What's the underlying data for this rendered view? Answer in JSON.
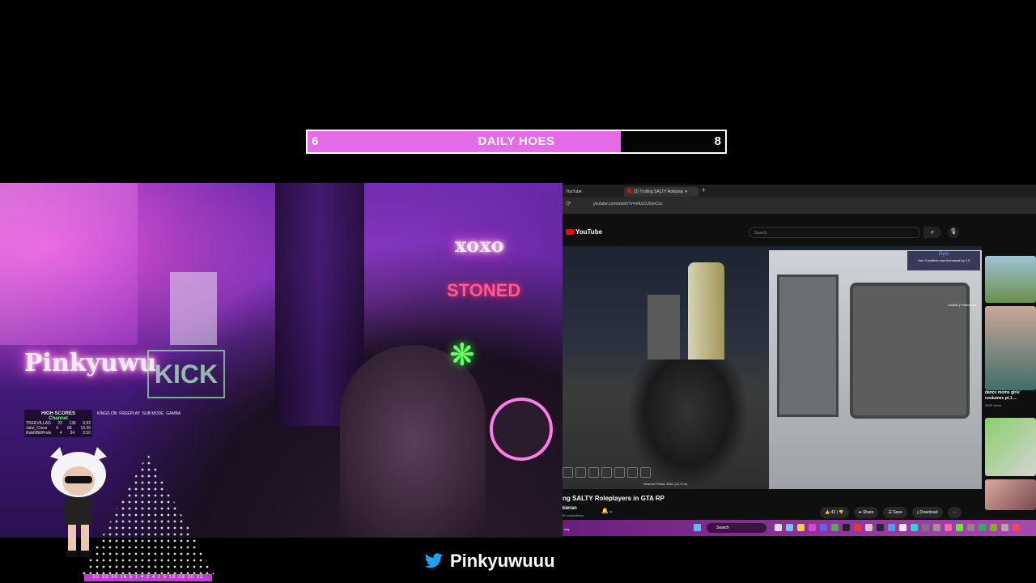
{
  "goal": {
    "title": "DAILY HOES",
    "current": "6",
    "target": "8",
    "progress": 0.75,
    "color": "#e46ce8"
  },
  "webcam": {
    "neon_name": "Pinkyuwu",
    "neon_xoxo": "xoxo",
    "neon_stoned": "STONED",
    "kick_sign": "KICK",
    "scoreboard": {
      "title": "HIGH SCORES",
      "subtitle": "Channel",
      "rows": [
        {
          "name": "TREEVILLAG",
          "a": "23",
          "b": "136",
          "c": "3.92"
        },
        {
          "name": "Jake_Cress",
          "a": "6",
          "b": "66",
          "c": "13.35"
        },
        {
          "name": "RobRBillProfe",
          "a": "4",
          "b": "34",
          "c": "3.50"
        }
      ]
    },
    "stats": {
      "lines": [
        "KINGS ON",
        "FREEPLAY",
        "SUB MODE",
        "GAMBA"
      ]
    }
  },
  "browser": {
    "tabs": [
      "YouTube",
      "(2) Trolling SALTY Roleplay"
    ],
    "url": "youtube.com/watch?v=mKoCUGorCxc",
    "yt_logo": "YouTube",
    "search_placeholder": "Search",
    "hud": {
      "notice_title": "Gym",
      "notice_text": "Your Condition was increased by 1.0",
      "postal": "Nearest Postal: 8052 (12.27m)",
      "civilian": "Civilian | Freelancer"
    },
    "video_title": "ng SALTY Roleplayers in GTA RP",
    "channel": "kieran",
    "subscribers": "80 subscribers",
    "actions": {
      "likes": "43",
      "share": "Share",
      "save": "Save",
      "download": "Download",
      "more": "⋯"
    },
    "sidebar": {
      "video1_title": "dance moms girls' costumes pt.1 ...",
      "video1_views": "953K views"
    },
    "taskbar": {
      "search": "Search",
      "weather": "ody"
    }
  },
  "social": {
    "twitter_handle": "Pinkyuwuuu"
  },
  "ticker": "32 33 30 16 5 1 4 2 4 1 5 18 29 30 32"
}
